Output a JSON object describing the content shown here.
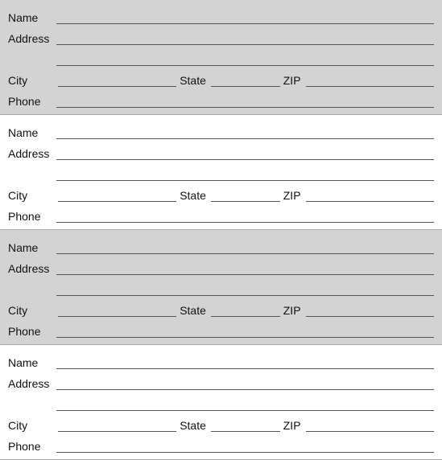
{
  "blocks": [
    {
      "shaded": true
    },
    {
      "shaded": false
    },
    {
      "shaded": true
    },
    {
      "shaded": false
    }
  ],
  "labels": {
    "name": "Name",
    "address": "Address",
    "city": "City",
    "state": "State",
    "zip": "ZIP",
    "phone": "Phone"
  }
}
